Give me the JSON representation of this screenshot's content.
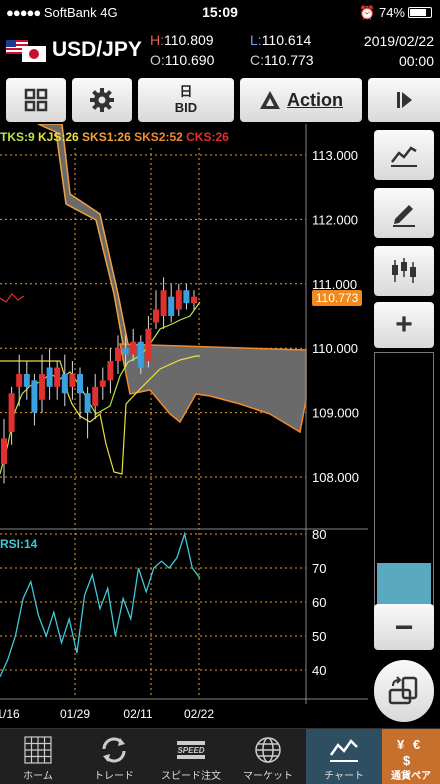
{
  "status": {
    "carrier": "SoftBank",
    "network": "4G",
    "time": "15:09",
    "battery": "74%"
  },
  "header": {
    "pair": "USD/JPY",
    "high_label": "H:",
    "high": "110.809",
    "low_label": "L:",
    "low": "110.614",
    "open_label": "O:",
    "open": "110.690",
    "close_label": "C:",
    "close": "110.773",
    "date": "2019/02/22",
    "time": "00:00"
  },
  "toolbar": {
    "bid_top": "日",
    "bid_bottom": "BID",
    "action_label": "Action"
  },
  "legend": {
    "tks": "TKS:9",
    "kjs": "KJS:26",
    "sks1": "SKS1:26",
    "sks2": "SKS2:52",
    "cks": "CKS:26",
    "colors": {
      "tks": "#b8e64a",
      "kjs": "#e8e040",
      "sks1": "#f0a040",
      "sks2": "#f08a30",
      "cks": "#e03030"
    }
  },
  "chart_data": {
    "type": "candlestick",
    "price_axis": {
      "ticks": [
        "113.000",
        "112.000",
        "111.000",
        "110.000",
        "109.000",
        "108.000"
      ]
    },
    "current_price": "110.773",
    "rsi_label": "RSI:14",
    "rsi_axis": {
      "ticks": [
        "80",
        "70",
        "60",
        "50",
        "40"
      ]
    },
    "rsi_color": "#40c8d8",
    "dates": [
      "1/16",
      "01/29",
      "02/11",
      "02/22"
    ],
    "candles": [
      [
        108.2,
        108.6,
        107.9,
        108.9
      ],
      [
        108.7,
        109.3,
        108.5,
        109.4
      ],
      [
        109.4,
        109.6,
        109.1,
        109.9
      ],
      [
        109.6,
        109.4,
        109.2,
        109.8
      ],
      [
        109.5,
        109.0,
        108.8,
        109.6
      ],
      [
        109.2,
        109.6,
        109.0,
        109.9
      ],
      [
        109.7,
        109.4,
        109.2,
        110.0
      ],
      [
        109.4,
        109.7,
        109.2,
        109.8
      ],
      [
        109.6,
        109.3,
        109.1,
        109.9
      ],
      [
        109.4,
        109.6,
        109.2,
        109.8
      ],
      [
        109.6,
        109.3,
        108.9,
        109.7
      ],
      [
        109.3,
        109.0,
        108.6,
        109.4
      ],
      [
        109.1,
        109.4,
        108.9,
        109.6
      ],
      [
        109.4,
        109.5,
        109.2,
        109.7
      ],
      [
        109.5,
        109.8,
        109.3,
        110.0
      ],
      [
        109.8,
        110.0,
        109.6,
        110.2
      ],
      [
        110.0,
        109.9,
        109.7,
        110.2
      ],
      [
        109.9,
        110.1,
        109.8,
        110.3
      ],
      [
        110.1,
        109.7,
        109.6,
        110.2
      ],
      [
        109.8,
        110.3,
        109.7,
        110.5
      ],
      [
        110.4,
        110.6,
        110.3,
        110.9
      ],
      [
        110.5,
        110.9,
        110.3,
        111.1
      ],
      [
        110.8,
        110.5,
        110.4,
        111.0
      ],
      [
        110.6,
        110.9,
        110.5,
        111.0
      ],
      [
        110.9,
        110.7,
        110.6,
        111.0
      ],
      [
        110.7,
        110.8,
        110.6,
        110.9
      ]
    ],
    "rsi": [
      38,
      43,
      50,
      61,
      66,
      56,
      50,
      57,
      48,
      55,
      45,
      62,
      68,
      58,
      64,
      50,
      61,
      55,
      70,
      63,
      70,
      72,
      70,
      73,
      80,
      70,
      67
    ]
  },
  "nav": [
    {
      "label": "ホーム",
      "icon": "home-grid-icon"
    },
    {
      "label": "トレード",
      "icon": "trade-arrows-icon"
    },
    {
      "label": "スピード注文",
      "icon": "speed-icon"
    },
    {
      "label": "マーケット",
      "icon": "globe-icon"
    },
    {
      "label": "チャート",
      "icon": "chart-icon"
    },
    {
      "label": "通貨ペア",
      "icon": "currency-pair-icon"
    }
  ]
}
